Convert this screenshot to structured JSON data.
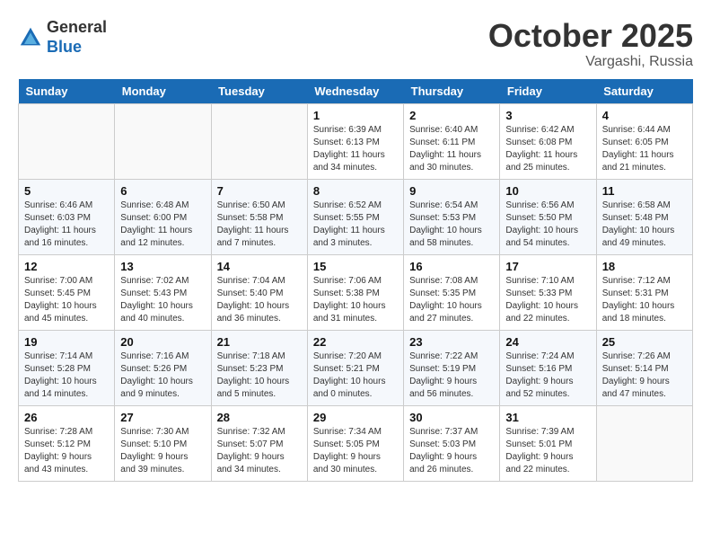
{
  "header": {
    "logo_general": "General",
    "logo_blue": "Blue",
    "month": "October 2025",
    "location": "Vargashi, Russia"
  },
  "days_of_week": [
    "Sunday",
    "Monday",
    "Tuesday",
    "Wednesday",
    "Thursday",
    "Friday",
    "Saturday"
  ],
  "weeks": [
    [
      {
        "day": "",
        "info": ""
      },
      {
        "day": "",
        "info": ""
      },
      {
        "day": "",
        "info": ""
      },
      {
        "day": "1",
        "info": "Sunrise: 6:39 AM\nSunset: 6:13 PM\nDaylight: 11 hours\nand 34 minutes."
      },
      {
        "day": "2",
        "info": "Sunrise: 6:40 AM\nSunset: 6:11 PM\nDaylight: 11 hours\nand 30 minutes."
      },
      {
        "day": "3",
        "info": "Sunrise: 6:42 AM\nSunset: 6:08 PM\nDaylight: 11 hours\nand 25 minutes."
      },
      {
        "day": "4",
        "info": "Sunrise: 6:44 AM\nSunset: 6:05 PM\nDaylight: 11 hours\nand 21 minutes."
      }
    ],
    [
      {
        "day": "5",
        "info": "Sunrise: 6:46 AM\nSunset: 6:03 PM\nDaylight: 11 hours\nand 16 minutes."
      },
      {
        "day": "6",
        "info": "Sunrise: 6:48 AM\nSunset: 6:00 PM\nDaylight: 11 hours\nand 12 minutes."
      },
      {
        "day": "7",
        "info": "Sunrise: 6:50 AM\nSunset: 5:58 PM\nDaylight: 11 hours\nand 7 minutes."
      },
      {
        "day": "8",
        "info": "Sunrise: 6:52 AM\nSunset: 5:55 PM\nDaylight: 11 hours\nand 3 minutes."
      },
      {
        "day": "9",
        "info": "Sunrise: 6:54 AM\nSunset: 5:53 PM\nDaylight: 10 hours\nand 58 minutes."
      },
      {
        "day": "10",
        "info": "Sunrise: 6:56 AM\nSunset: 5:50 PM\nDaylight: 10 hours\nand 54 minutes."
      },
      {
        "day": "11",
        "info": "Sunrise: 6:58 AM\nSunset: 5:48 PM\nDaylight: 10 hours\nand 49 minutes."
      }
    ],
    [
      {
        "day": "12",
        "info": "Sunrise: 7:00 AM\nSunset: 5:45 PM\nDaylight: 10 hours\nand 45 minutes."
      },
      {
        "day": "13",
        "info": "Sunrise: 7:02 AM\nSunset: 5:43 PM\nDaylight: 10 hours\nand 40 minutes."
      },
      {
        "day": "14",
        "info": "Sunrise: 7:04 AM\nSunset: 5:40 PM\nDaylight: 10 hours\nand 36 minutes."
      },
      {
        "day": "15",
        "info": "Sunrise: 7:06 AM\nSunset: 5:38 PM\nDaylight: 10 hours\nand 31 minutes."
      },
      {
        "day": "16",
        "info": "Sunrise: 7:08 AM\nSunset: 5:35 PM\nDaylight: 10 hours\nand 27 minutes."
      },
      {
        "day": "17",
        "info": "Sunrise: 7:10 AM\nSunset: 5:33 PM\nDaylight: 10 hours\nand 22 minutes."
      },
      {
        "day": "18",
        "info": "Sunrise: 7:12 AM\nSunset: 5:31 PM\nDaylight: 10 hours\nand 18 minutes."
      }
    ],
    [
      {
        "day": "19",
        "info": "Sunrise: 7:14 AM\nSunset: 5:28 PM\nDaylight: 10 hours\nand 14 minutes."
      },
      {
        "day": "20",
        "info": "Sunrise: 7:16 AM\nSunset: 5:26 PM\nDaylight: 10 hours\nand 9 minutes."
      },
      {
        "day": "21",
        "info": "Sunrise: 7:18 AM\nSunset: 5:23 PM\nDaylight: 10 hours\nand 5 minutes."
      },
      {
        "day": "22",
        "info": "Sunrise: 7:20 AM\nSunset: 5:21 PM\nDaylight: 10 hours\nand 0 minutes."
      },
      {
        "day": "23",
        "info": "Sunrise: 7:22 AM\nSunset: 5:19 PM\nDaylight: 9 hours\nand 56 minutes."
      },
      {
        "day": "24",
        "info": "Sunrise: 7:24 AM\nSunset: 5:16 PM\nDaylight: 9 hours\nand 52 minutes."
      },
      {
        "day": "25",
        "info": "Sunrise: 7:26 AM\nSunset: 5:14 PM\nDaylight: 9 hours\nand 47 minutes."
      }
    ],
    [
      {
        "day": "26",
        "info": "Sunrise: 7:28 AM\nSunset: 5:12 PM\nDaylight: 9 hours\nand 43 minutes."
      },
      {
        "day": "27",
        "info": "Sunrise: 7:30 AM\nSunset: 5:10 PM\nDaylight: 9 hours\nand 39 minutes."
      },
      {
        "day": "28",
        "info": "Sunrise: 7:32 AM\nSunset: 5:07 PM\nDaylight: 9 hours\nand 34 minutes."
      },
      {
        "day": "29",
        "info": "Sunrise: 7:34 AM\nSunset: 5:05 PM\nDaylight: 9 hours\nand 30 minutes."
      },
      {
        "day": "30",
        "info": "Sunrise: 7:37 AM\nSunset: 5:03 PM\nDaylight: 9 hours\nand 26 minutes."
      },
      {
        "day": "31",
        "info": "Sunrise: 7:39 AM\nSunset: 5:01 PM\nDaylight: 9 hours\nand 22 minutes."
      },
      {
        "day": "",
        "info": ""
      }
    ]
  ]
}
